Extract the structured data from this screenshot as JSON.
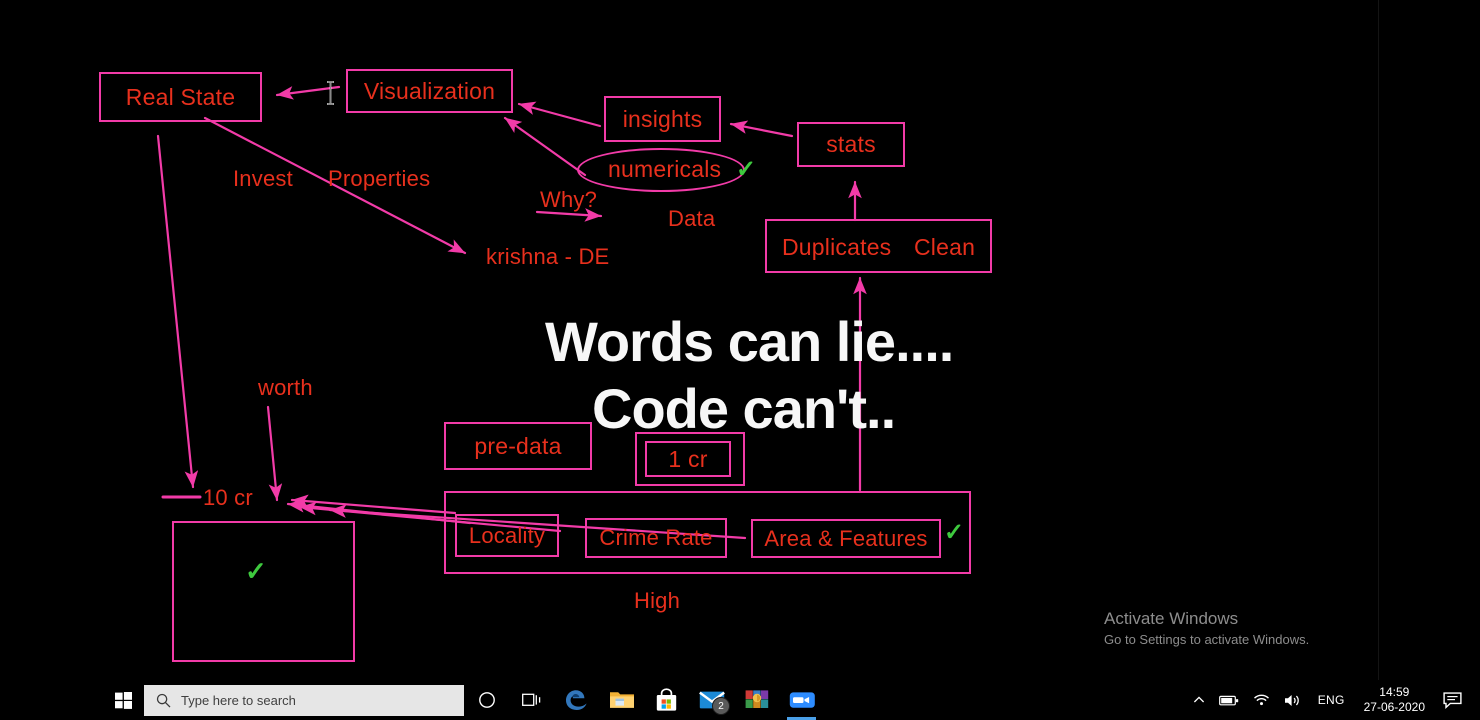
{
  "canvas": {
    "headline_line1": "Words can lie....",
    "headline_line2": "Code can't..",
    "boxes": {
      "real_state": "Real State",
      "visualization": "Visualization",
      "insights": "insights",
      "stats": "stats",
      "numericals": "numericals",
      "duplicates": "Duplicates",
      "clean": "Clean",
      "pre_data": "pre-data",
      "one_cr": "1 cr",
      "locality": "Locality",
      "crime_rate": "Crime Rate",
      "area_features": "Area & Features"
    },
    "notes": {
      "invest": "Invest",
      "properties": "Properties",
      "krishna_de": "krishna - DE",
      "why": "Why?",
      "data": "Data",
      "worth": "worth",
      "ten_cr": "10 cr",
      "high": "High"
    },
    "checks": {
      "numericals_check": "✓",
      "area_features_check": "✓",
      "empty_box_check": "✓"
    },
    "colors": {
      "ink_box": "#f23ba8",
      "ink_text": "#e8301d",
      "check_green": "#3ec93e",
      "headline": "#f7f7f7",
      "background": "#000000"
    }
  },
  "watermark": {
    "title": "Activate Windows",
    "subtitle": "Go to Settings to activate Windows."
  },
  "taskbar": {
    "start_label": "Start",
    "search": {
      "placeholder": "Type here to search",
      "value": ""
    },
    "icons": [
      {
        "name": "cortana-icon",
        "label": "Cortana"
      },
      {
        "name": "task-view-icon",
        "label": "Task View"
      },
      {
        "name": "edge-icon",
        "label": "Microsoft Edge"
      },
      {
        "name": "file-explorer-icon",
        "label": "File Explorer"
      },
      {
        "name": "microsoft-store-icon",
        "label": "Microsoft Store"
      },
      {
        "name": "mail-icon",
        "label": "Mail",
        "badge": "2"
      },
      {
        "name": "winrar-icon",
        "label": "WinRAR"
      },
      {
        "name": "zoom-icon",
        "label": "Zoom",
        "active": true
      }
    ],
    "tray": {
      "language": "ENG",
      "time": "14:59",
      "date": "27-06-2020"
    }
  }
}
